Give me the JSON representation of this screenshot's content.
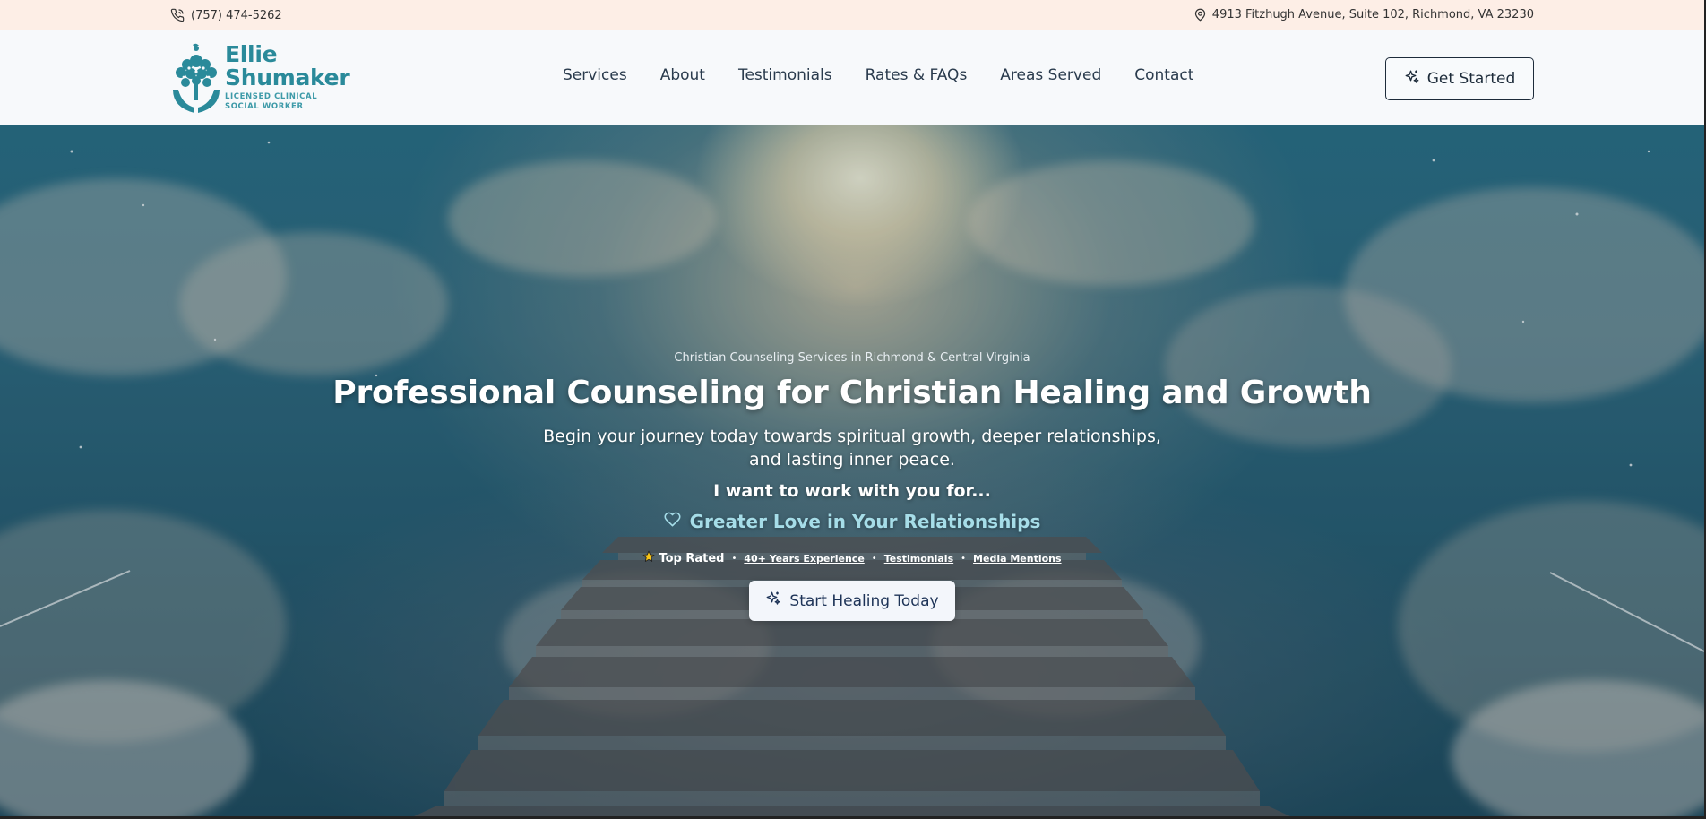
{
  "topbar": {
    "phone": "(757) 474-5262",
    "address": "4913 Fitzhugh Avenue, Suite 102, Richmond, VA 23230"
  },
  "logo": {
    "name_line1": "Ellie",
    "name_line2": "Shumaker",
    "subtitle_line1": "LICENSED CLINICAL",
    "subtitle_line2": "SOCIAL WORKER"
  },
  "nav": {
    "items": [
      {
        "label": "Services"
      },
      {
        "label": "About"
      },
      {
        "label": "Testimonials"
      },
      {
        "label": "Rates & FAQs"
      },
      {
        "label": "Areas Served"
      },
      {
        "label": "Contact"
      }
    ],
    "cta_label": "Get Started"
  },
  "hero": {
    "eyebrow": "Christian Counseling Services in Richmond & Central Virginia",
    "headline": "Professional Counseling for Christian Healing and Growth",
    "subhead_line1": "Begin your journey today towards spiritual growth, deeper relationships,",
    "subhead_line2": "and lasting inner peace.",
    "intro": "I want to work with you for...",
    "rotating_text": "Greater Love in Your Relationships",
    "badges": {
      "top_rated": "Top Rated",
      "experience": "40+ Years Experience",
      "testimonials": "Testimonials",
      "media": "Media Mentions"
    },
    "cta_label": "Start Healing Today"
  },
  "colors": {
    "topbar_bg": "#fdeee6",
    "header_bg": "#f7f9fb",
    "brand_teal": "#2a8a9a",
    "nav_text": "#2a3b4d",
    "rotator_text": "#a6dde8",
    "cta_text": "#1d3357"
  },
  "icons": {
    "phone": "phone-icon",
    "address": "map-pin-icon",
    "cta": "sparkles-icon",
    "rotator": "heart-icon",
    "top_rated": "star-icon"
  }
}
